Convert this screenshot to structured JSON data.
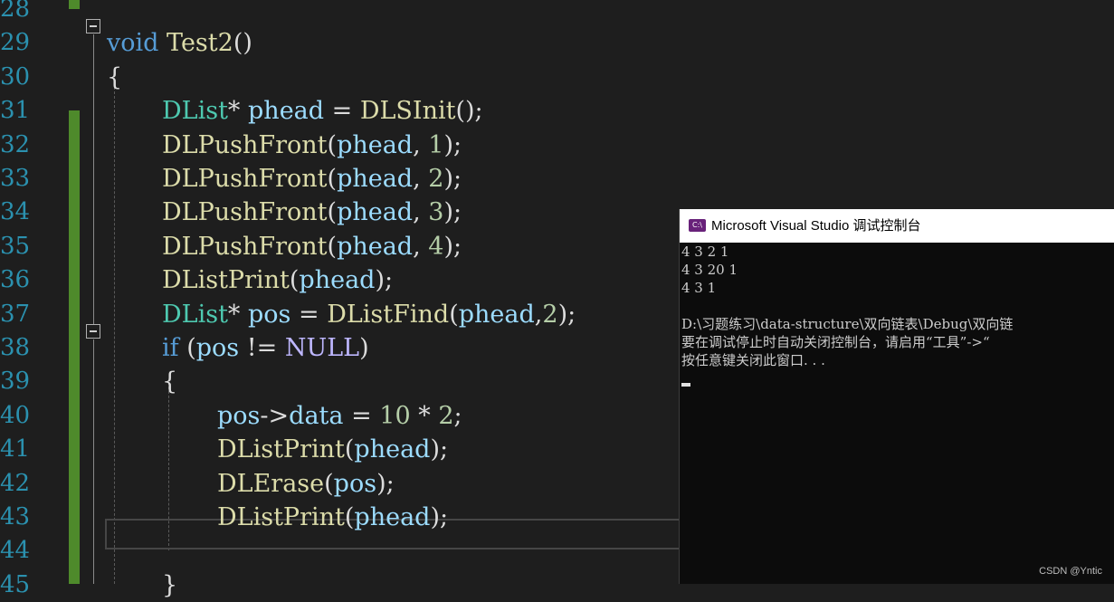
{
  "editor": {
    "line_numbers": [
      "28",
      "29",
      "30",
      "31",
      "32",
      "33",
      "34",
      "35",
      "36",
      "37",
      "38",
      "39",
      "40",
      "41",
      "42",
      "43",
      "44",
      "45"
    ],
    "lines": [
      {
        "n": "29",
        "tokens": [
          {
            "t": "void",
            "c": "kw"
          },
          {
            "t": " ",
            "c": "punc"
          },
          {
            "t": "Test2",
            "c": "fn"
          },
          {
            "t": "()",
            "c": "punc"
          }
        ]
      },
      {
        "n": "30",
        "tokens": [
          {
            "t": "{",
            "c": "punc"
          }
        ]
      },
      {
        "n": "31",
        "tokens": [
          {
            "t": "DList",
            "c": "ty"
          },
          {
            "t": "* ",
            "c": "punc"
          },
          {
            "t": "phead",
            "c": "var"
          },
          {
            "t": " = ",
            "c": "punc"
          },
          {
            "t": "DLSInit",
            "c": "fn"
          },
          {
            "t": "();",
            "c": "punc"
          }
        ]
      },
      {
        "n": "32",
        "tokens": [
          {
            "t": "DLPushFront",
            "c": "fn"
          },
          {
            "t": "(",
            "c": "punc"
          },
          {
            "t": "phead",
            "c": "var"
          },
          {
            "t": ", ",
            "c": "punc"
          },
          {
            "t": "1",
            "c": "num"
          },
          {
            "t": ");",
            "c": "punc"
          }
        ]
      },
      {
        "n": "33",
        "tokens": [
          {
            "t": "DLPushFront",
            "c": "fn"
          },
          {
            "t": "(",
            "c": "punc"
          },
          {
            "t": "phead",
            "c": "var"
          },
          {
            "t": ", ",
            "c": "punc"
          },
          {
            "t": "2",
            "c": "num"
          },
          {
            "t": ");",
            "c": "punc"
          }
        ]
      },
      {
        "n": "34",
        "tokens": [
          {
            "t": "DLPushFront",
            "c": "fn"
          },
          {
            "t": "(",
            "c": "punc"
          },
          {
            "t": "phead",
            "c": "var"
          },
          {
            "t": ", ",
            "c": "punc"
          },
          {
            "t": "3",
            "c": "num"
          },
          {
            "t": ");",
            "c": "punc"
          }
        ]
      },
      {
        "n": "35",
        "tokens": [
          {
            "t": "DLPushFront",
            "c": "fn"
          },
          {
            "t": "(",
            "c": "punc"
          },
          {
            "t": "phead",
            "c": "var"
          },
          {
            "t": ", ",
            "c": "punc"
          },
          {
            "t": "4",
            "c": "num"
          },
          {
            "t": ");",
            "c": "punc"
          }
        ]
      },
      {
        "n": "36",
        "tokens": [
          {
            "t": "DListPrint",
            "c": "fn"
          },
          {
            "t": "(",
            "c": "punc"
          },
          {
            "t": "phead",
            "c": "var"
          },
          {
            "t": ");",
            "c": "punc"
          }
        ]
      },
      {
        "n": "37",
        "tokens": [
          {
            "t": "DList",
            "c": "ty"
          },
          {
            "t": "* ",
            "c": "punc"
          },
          {
            "t": "pos",
            "c": "var"
          },
          {
            "t": " = ",
            "c": "punc"
          },
          {
            "t": "DListFind",
            "c": "fn"
          },
          {
            "t": "(",
            "c": "punc"
          },
          {
            "t": "phead",
            "c": "var"
          },
          {
            "t": ",",
            "c": "punc"
          },
          {
            "t": "2",
            "c": "num"
          },
          {
            "t": ");",
            "c": "punc"
          }
        ]
      },
      {
        "n": "38",
        "tokens": [
          {
            "t": "if",
            "c": "kw"
          },
          {
            "t": " (",
            "c": "punc"
          },
          {
            "t": "pos",
            "c": "var"
          },
          {
            "t": " != ",
            "c": "punc"
          },
          {
            "t": "NULL",
            "c": "mac"
          },
          {
            "t": ")",
            "c": "punc"
          }
        ]
      },
      {
        "n": "39",
        "tokens": [
          {
            "t": "{",
            "c": "punc"
          }
        ]
      },
      {
        "n": "40",
        "tokens": [
          {
            "t": "pos",
            "c": "var"
          },
          {
            "t": "->",
            "c": "punc"
          },
          {
            "t": "data",
            "c": "var"
          },
          {
            "t": " = ",
            "c": "punc"
          },
          {
            "t": "10",
            "c": "num"
          },
          {
            "t": " * ",
            "c": "punc"
          },
          {
            "t": "2",
            "c": "num"
          },
          {
            "t": ";",
            "c": "punc"
          }
        ]
      },
      {
        "n": "41",
        "tokens": [
          {
            "t": "DListPrint",
            "c": "fn"
          },
          {
            "t": "(",
            "c": "punc"
          },
          {
            "t": "phead",
            "c": "var"
          },
          {
            "t": ");",
            "c": "punc"
          }
        ]
      },
      {
        "n": "42",
        "tokens": [
          {
            "t": "DLErase",
            "c": "fn"
          },
          {
            "t": "(",
            "c": "punc"
          },
          {
            "t": "pos",
            "c": "var"
          },
          {
            "t": ");",
            "c": "punc"
          }
        ]
      },
      {
        "n": "43",
        "tokens": [
          {
            "t": "DListPrint",
            "c": "fn"
          },
          {
            "t": "(",
            "c": "punc"
          },
          {
            "t": "phead",
            "c": "var"
          },
          {
            "t": ");",
            "c": "punc"
          }
        ]
      },
      {
        "n": "44",
        "tokens": []
      },
      {
        "n": "45",
        "tokens": [
          {
            "t": "}",
            "c": "punc"
          }
        ]
      }
    ]
  },
  "console": {
    "title": "Microsoft Visual Studio 调试控制台",
    "icon": "vs-console-icon",
    "icon_text": "C:\\",
    "output_lines": [
      "4 3 2 1",
      "4 3 20 1",
      "4 3 1",
      "",
      "D:\\习题练习\\data-structure\\双向链表\\Debug\\双向链",
      "要在调试停止时自动关闭控制台，请启用“工具”->“",
      "按任意键关闭此窗口. . ."
    ]
  },
  "watermark": "CSDN @Yntic",
  "colors": {
    "keyword": "#569cd6",
    "type": "#4ec9b0",
    "function": "#dcdcaa",
    "variable": "#9cdcfe",
    "number": "#b5cea8",
    "macro": "#beb7ff",
    "line_number": "#2b91af",
    "change_bar": "#4e8a2b"
  }
}
